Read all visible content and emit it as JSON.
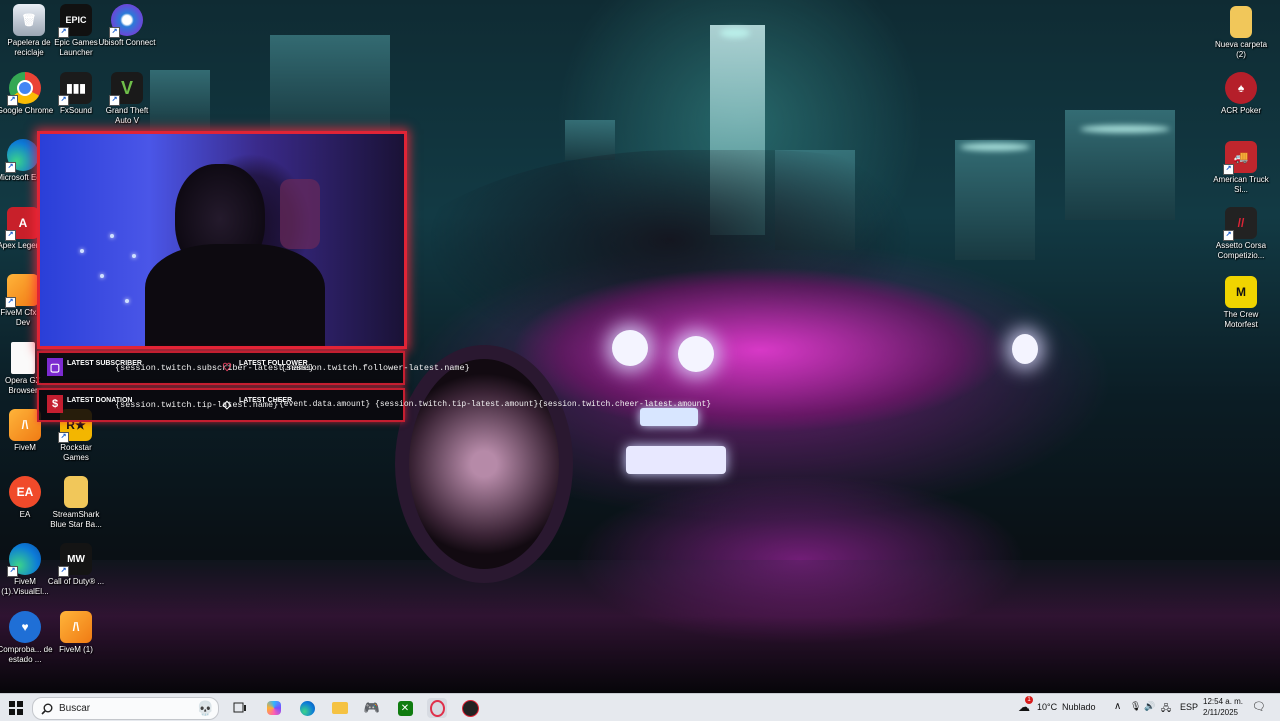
{
  "desktop": {
    "icons_left_col1": [
      {
        "label": "Papelera de reciclaje",
        "icon": "recycle-bin-icon"
      },
      {
        "label": "Google Chrome",
        "icon": "chrome-icon"
      },
      {
        "label": "Microsoft Edge",
        "icon": "edge-icon"
      },
      {
        "label": "Apex Legends",
        "icon": "apex-icon"
      },
      {
        "label": "FiveM Cfx.re Dev",
        "icon": "fivem-icon"
      },
      {
        "label": "Opera GX Browser",
        "icon": "file-icon"
      },
      {
        "label": "FiveM",
        "icon": "fivem-icon"
      },
      {
        "label": "EA",
        "icon": "ea-icon"
      },
      {
        "label": "FiveM (1).VisualEl...",
        "icon": "edge-icon"
      },
      {
        "label": "Comproba... de estado ...",
        "icon": "health-check-icon"
      }
    ],
    "icons_left_col2": [
      {
        "label": "Epic Games Launcher",
        "icon": "epic-games-icon"
      },
      {
        "label": "FxSound",
        "icon": "fxsound-icon"
      },
      {
        "label": "Rockstar Games",
        "icon": "rockstar-icon"
      },
      {
        "label": "StreamShark Blue Star Ba...",
        "icon": "folder-icon"
      },
      {
        "label": "Call of Duty® ...",
        "icon": "cod-icon"
      },
      {
        "label": "FiveM (1)",
        "icon": "fivem-icon"
      }
    ],
    "icons_left_col3": [
      {
        "label": "Ubisoft Connect",
        "icon": "ubisoft-icon"
      },
      {
        "label": "Grand Theft Auto V",
        "icon": "gta-icon"
      }
    ],
    "icons_right": [
      {
        "label": "Nueva carpeta (2)",
        "icon": "folder-icon"
      },
      {
        "label": "ACR Poker",
        "icon": "poker-icon"
      },
      {
        "label": "American Truck Si...",
        "icon": "truck-icon"
      },
      {
        "label": "Assetto Corsa Competizio...",
        "icon": "assetto-icon"
      },
      {
        "label": "The Crew Motorfest",
        "icon": "crew-icon"
      }
    ]
  },
  "overlay": {
    "latest_subscriber_label": "LATEST SUBSCRIBER",
    "latest_subscriber_value": "{session.twitch.subscriber-latest.name}",
    "latest_follower_label": "LATEST FOLLOWER",
    "latest_follower_value": "{session.twitch.follower-latest.name}",
    "latest_donation_label": "LATEST DONATION",
    "latest_donation_value": "{session.twitch.tip-latest.name}",
    "latest_cheer_label": "LATEST CHEER",
    "latest_cheer_value": "{event.data.amount} {session.twitch.tip-latest.amount}{session.twitch.cheer-latest.amount}"
  },
  "taskbar": {
    "search_placeholder": "Buscar",
    "weather_temp": "10°C",
    "weather_desc": "Nublado",
    "language": "ESP",
    "time": "12:54 a. m.",
    "date": "2/11/2025",
    "notification_count": "1"
  },
  "colors": {
    "accent_red": "#e02436",
    "taskbar_bg": "#e6e9ee"
  }
}
